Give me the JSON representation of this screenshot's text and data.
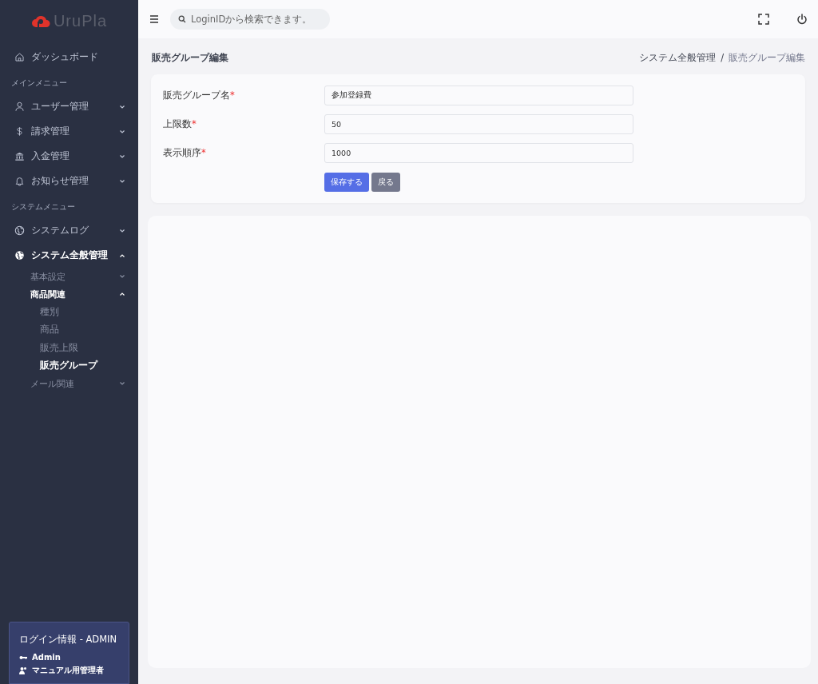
{
  "brand": {
    "name": "UruPla"
  },
  "sidebar": {
    "menu": [
      {
        "kind": "item",
        "label": "ダッシュボード",
        "selected": false
      },
      {
        "kind": "section",
        "label": "メインメニュー"
      },
      {
        "kind": "item",
        "label": "ユーザー管理",
        "expanded": false,
        "selected": false
      },
      {
        "kind": "item",
        "label": "請求管理",
        "expanded": false,
        "selected": false
      },
      {
        "kind": "item",
        "label": "入金管理",
        "expanded": false,
        "selected": false
      },
      {
        "kind": "item",
        "label": "お知らせ管理",
        "expanded": false,
        "selected": false
      },
      {
        "kind": "section",
        "label": "システムメニュー"
      },
      {
        "kind": "item",
        "label": "システムログ",
        "expanded": false,
        "selected": false
      },
      {
        "kind": "item",
        "label": "システム全般管理",
        "expanded": true,
        "selected": true,
        "children": [
          {
            "label": "基本設定",
            "expanded": false,
            "selected": false
          },
          {
            "label": "商品関連",
            "expanded": true,
            "selected": true,
            "children": [
              {
                "label": "種別",
                "selected": false
              },
              {
                "label": "商品",
                "selected": false
              },
              {
                "label": "販売上限",
                "selected": false
              },
              {
                "label": "販売グループ",
                "selected": true
              }
            ]
          },
          {
            "label": "メール関連",
            "expanded": false,
            "selected": false
          }
        ]
      }
    ],
    "login": {
      "title": "ログイン情報 - ADMIN",
      "user": "Admin",
      "role": "マニュアル用管理者"
    }
  },
  "header": {
    "search": {
      "placeholder": "LoginIDから検索できます。"
    }
  },
  "page": {
    "title": "販売グループ編集",
    "breadcrumb": [
      {
        "label": "システム全般管理",
        "current": false
      },
      {
        "label": "販売グループ編集",
        "current": true
      }
    ],
    "separator": "/"
  },
  "form": {
    "fields": [
      {
        "label": "販売グループ名",
        "mark": "*",
        "value": "参加登録費"
      },
      {
        "label": "上限数",
        "mark": "*",
        "value": "50"
      },
      {
        "label": "表示順序",
        "mark": "*",
        "value": "1000"
      }
    ],
    "buttons": [
      {
        "kind": "primary",
        "label": "保存する"
      },
      {
        "kind": "secondary",
        "label": "戻る"
      }
    ]
  }
}
